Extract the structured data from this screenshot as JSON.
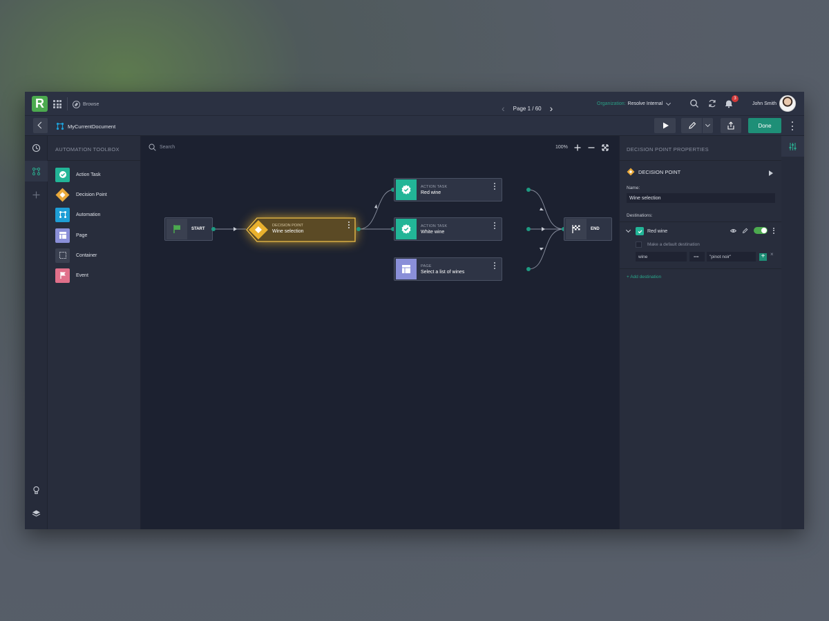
{
  "app": {
    "logo_letter": "R",
    "browse_label": "Browse",
    "page_indicator": "Page 1 / 60",
    "org_label": "Organization:",
    "org_value": "Resolve Internal",
    "notification_count": "3",
    "user_name": "John Smith"
  },
  "document": {
    "name": "MyCurrentDocument",
    "done_label": "Done"
  },
  "toolbox": {
    "title": "AUTOMATION TOOLBOX",
    "items": [
      {
        "label": "Action Task",
        "icon": "check-badge-icon",
        "color": "#22b597"
      },
      {
        "label": "Decision Point",
        "icon": "diamond-icon",
        "color": "#e9a93b"
      },
      {
        "label": "Automation",
        "icon": "automation-icon",
        "color": "#1e9ed6"
      },
      {
        "label": "Page",
        "icon": "page-layout-icon",
        "color": "#8a8fd8"
      },
      {
        "label": "Container",
        "icon": "container-icon",
        "color": "#3a4050"
      },
      {
        "label": "Event",
        "icon": "flag-icon",
        "color": "#e0708a"
      }
    ]
  },
  "canvas": {
    "search_placeholder": "Search",
    "zoom_level": "100%",
    "nodes": {
      "start": {
        "label": "START"
      },
      "decision": {
        "kind": "DECISION POINT",
        "title": "Wine selection"
      },
      "red": {
        "kind": "ACTION TASK",
        "title": "Red wine"
      },
      "white": {
        "kind": "ACTION TASK",
        "title": "White wine"
      },
      "page": {
        "kind": "PAGE",
        "title": "Select a list of wines"
      },
      "end": {
        "label": "END"
      }
    }
  },
  "properties": {
    "title": "DECISION POINT PROPERTIES",
    "type_label": "DECISION POINT",
    "name_label": "Name:",
    "name_value": "Wine selection",
    "destinations_label": "Destinations:",
    "destination": {
      "name": "Red wine",
      "default_label": "Make a default destination",
      "enabled": true,
      "condition": {
        "left": "wine",
        "operator": "==",
        "right": "\"pinot noir\""
      }
    },
    "add_destination_label": "+ Add destination"
  },
  "colors": {
    "accent": "#1e8f77",
    "decision": "#e9b12e",
    "action": "#22b597",
    "page": "#8a8fd8",
    "start": "#4caa4f"
  }
}
